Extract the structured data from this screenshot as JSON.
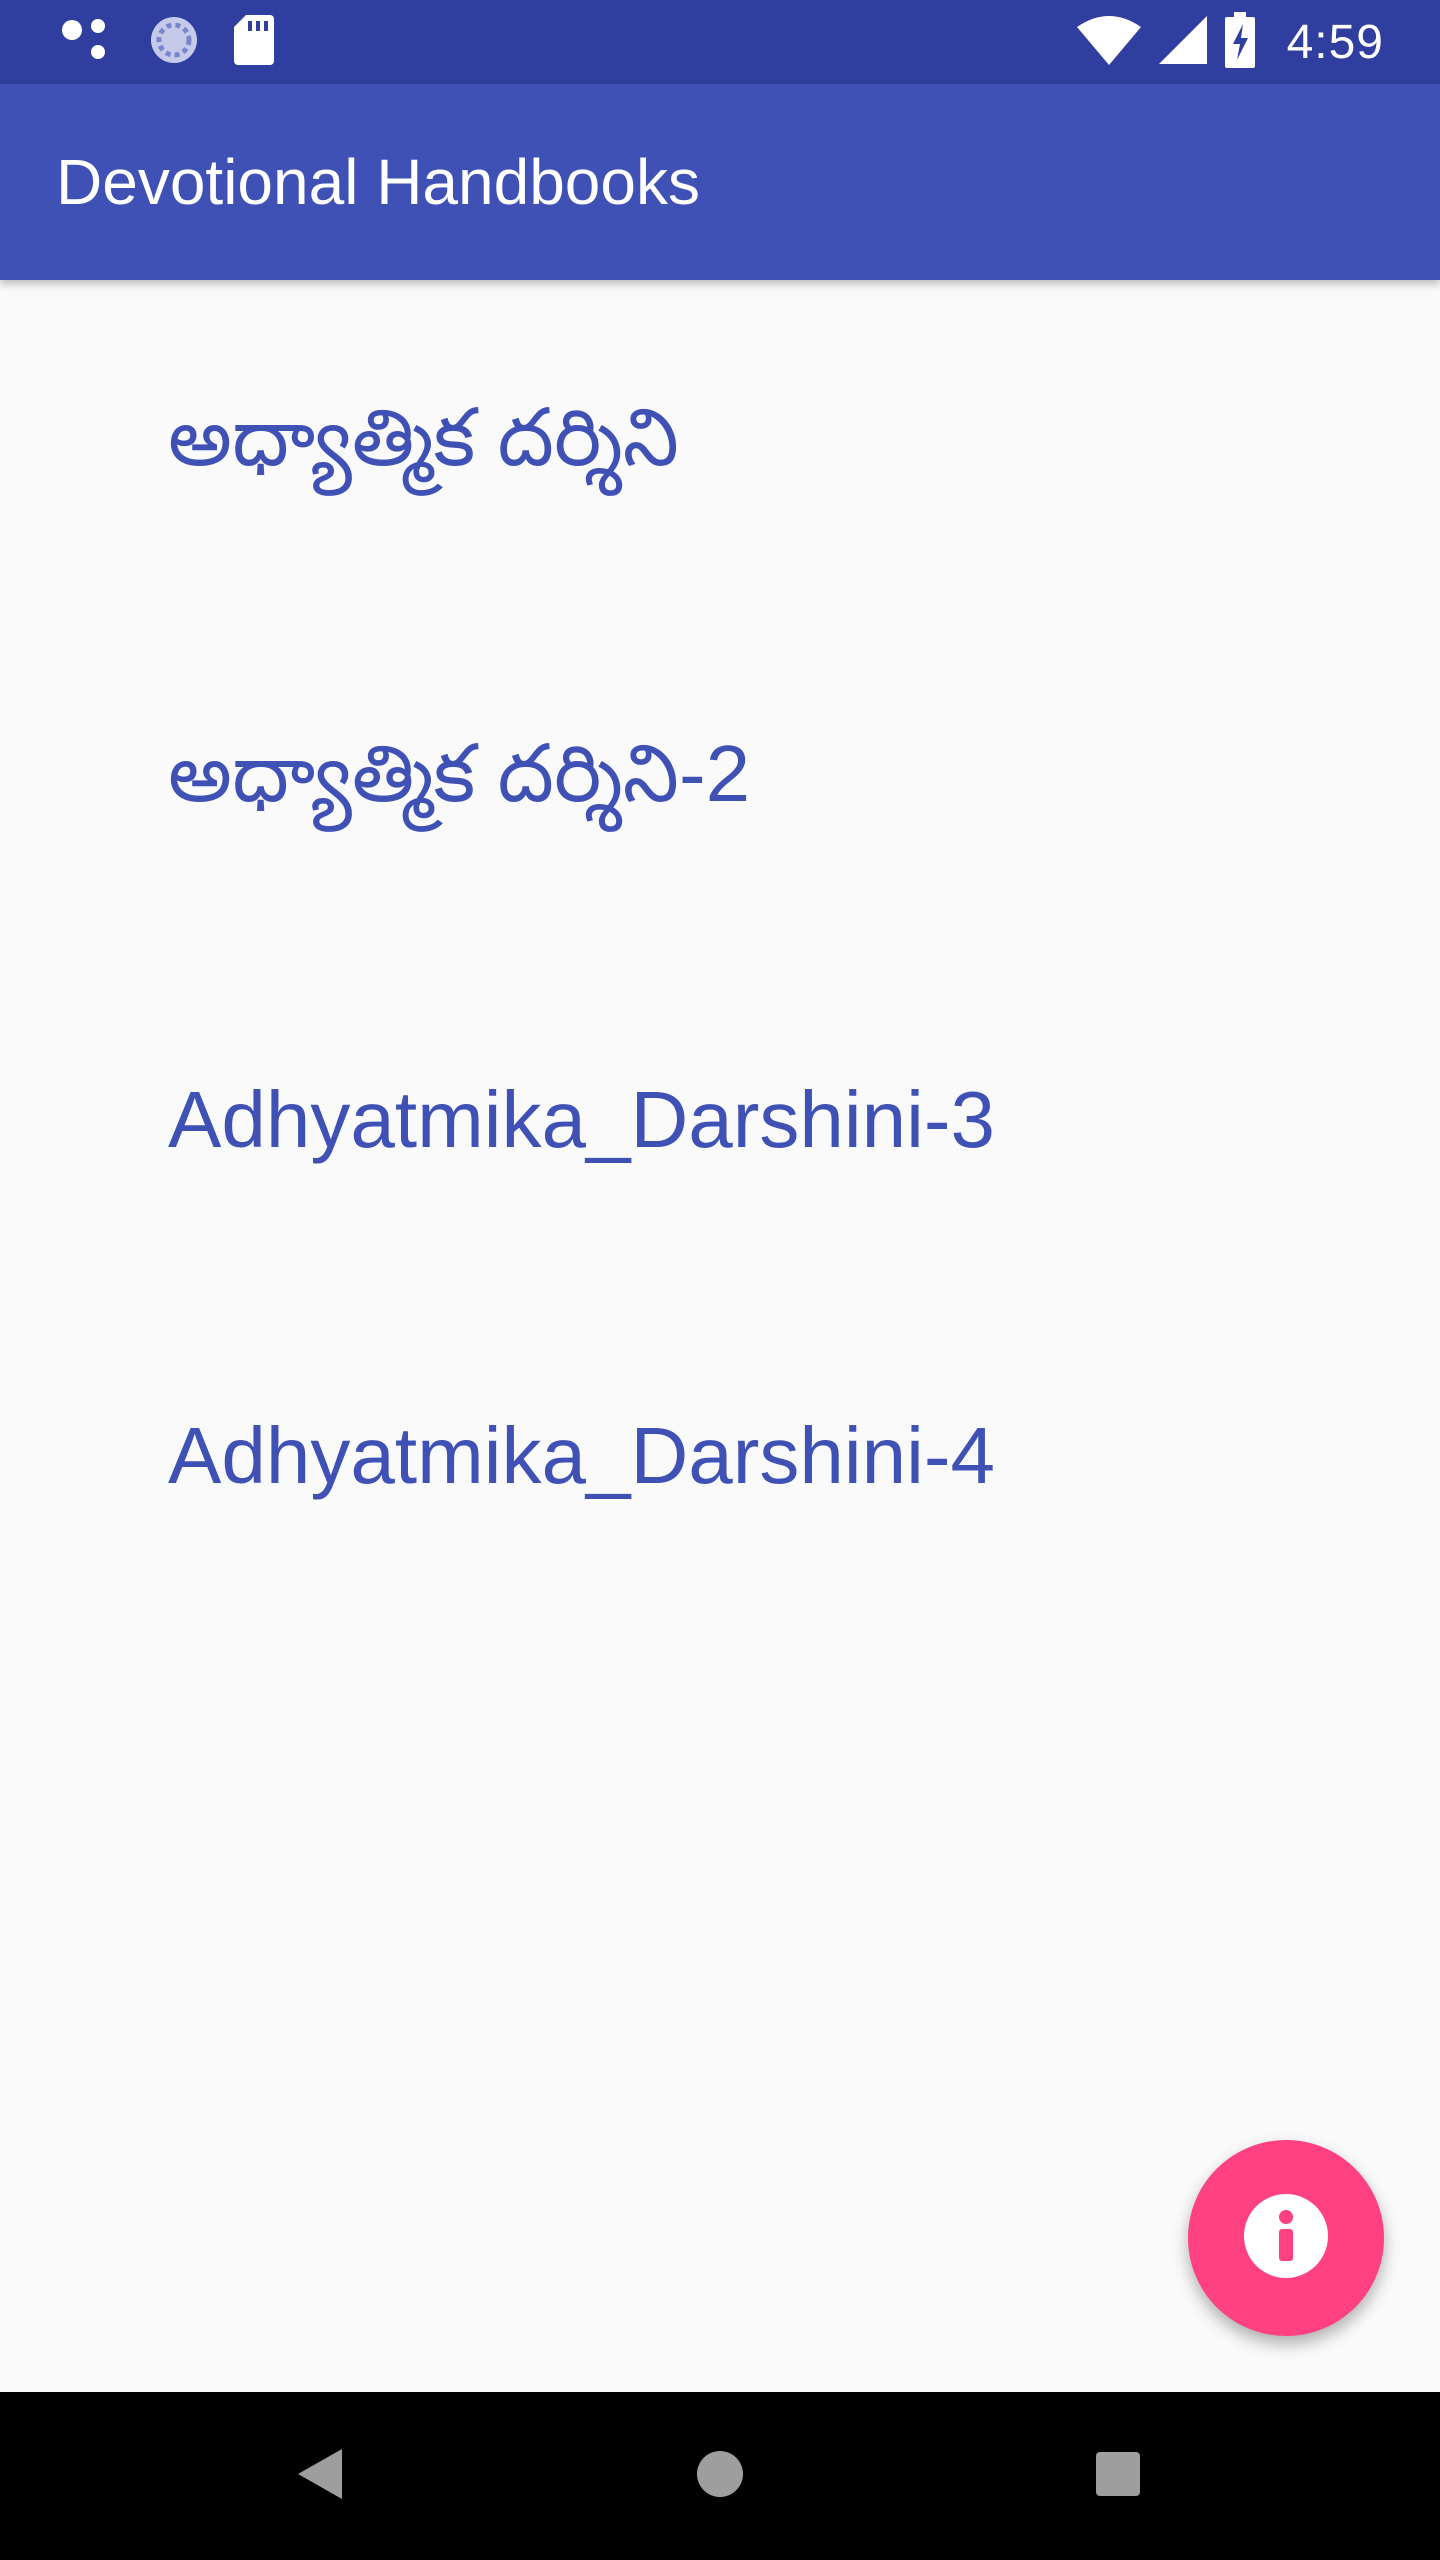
{
  "status_bar": {
    "time": "4:59",
    "left_icons": [
      "notification-dots-icon",
      "sync-icon",
      "sd-card-icon"
    ],
    "right_icons": [
      "wifi-icon",
      "cell-signal-icon",
      "battery-charging-icon"
    ]
  },
  "app_bar": {
    "title": "Devotional Handbooks"
  },
  "books": [
    {
      "title": "అధ్యాత్మిక దర్శిని"
    },
    {
      "title": "అధ్యాత్మిక దర్శిని-2"
    },
    {
      "title": "Adhyatmika_Darshini-3"
    },
    {
      "title": "Adhyatmika_Darshini-4"
    }
  ],
  "fab": {
    "icon": "info-icon"
  },
  "colors": {
    "status_bar": "#303f9f",
    "primary": "#3f51b5",
    "accent": "#ff4081",
    "background": "#fafafa"
  },
  "nav_bar": {
    "buttons": [
      "back-icon",
      "home-icon",
      "recents-icon"
    ]
  }
}
